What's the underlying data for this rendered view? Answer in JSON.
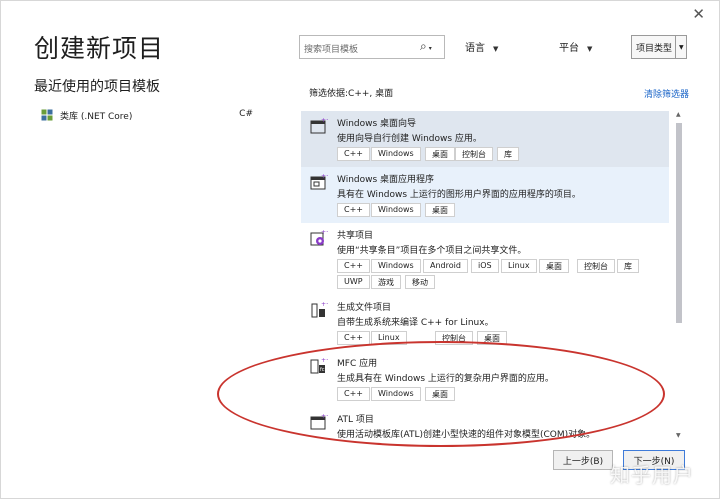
{
  "window": {
    "title": "创建新项目",
    "close_glyph": "✕"
  },
  "recent": {
    "heading": "最近使用的项目模板",
    "items": [
      {
        "name": "类库 (.NET Core)",
        "lang": "C#"
      }
    ]
  },
  "search": {
    "placeholder": "搜索项目模板"
  },
  "filters": {
    "language": "语言",
    "platform": "平台",
    "project_type": "项目类型"
  },
  "filter_info": "筛选依据:C++, 桌面",
  "clear_filters": "清除筛选器",
  "templates": [
    {
      "name": "Windows 桌面向导",
      "desc": "使用向导自行创建 Windows 应用。",
      "tags": [
        "C++",
        "Windows",
        "桌面",
        "控制台",
        "库"
      ],
      "state": "selected",
      "icon": "wizard-icon"
    },
    {
      "name": "Windows 桌面应用程序",
      "desc": "具有在 Windows 上运行的图形用户界面的应用程序的项目。",
      "tags": [
        "C++",
        "Windows",
        "桌面"
      ],
      "state": "hover",
      "icon": "desktop-app-icon"
    },
    {
      "name": "共享项目",
      "desc": "使用“共享条目”项目在多个项目之间共享文件。",
      "tags": [
        "C++",
        "Windows",
        "Android",
        "iOS",
        "Linux",
        "桌面",
        "控制台",
        "库",
        "UWP",
        "游戏",
        "移动"
      ],
      "state": "normal",
      "icon": "shared-project-icon"
    },
    {
      "name": "生成文件项目",
      "desc": "自带生成系统来编译 C++ for Linux。",
      "tags": [
        "C++",
        "Linux",
        "控制台",
        "桌面"
      ],
      "state": "normal",
      "icon": "makefile-icon"
    },
    {
      "name": "MFC 应用",
      "desc": "生成具有在 Windows 上运行的复杂用户界面的应用。",
      "tags": [
        "C++",
        "Windows",
        "桌面"
      ],
      "state": "normal",
      "icon": "mfc-icon"
    },
    {
      "name": "ATL 项目",
      "desc": "使用活动模板库(ATL)创建小型快速的组件对象模型(COM)对象。",
      "tags": [],
      "state": "normal",
      "icon": "atl-icon"
    }
  ],
  "buttons": {
    "prev": "上一步(B)",
    "next": "下一步(N)"
  },
  "watermark": "知乎用户",
  "colors": {
    "accent": "#1a64c8",
    "selected_bg": "#dfe6ef",
    "hover_bg": "#e8f1fb",
    "annotation": "#c9342e"
  }
}
